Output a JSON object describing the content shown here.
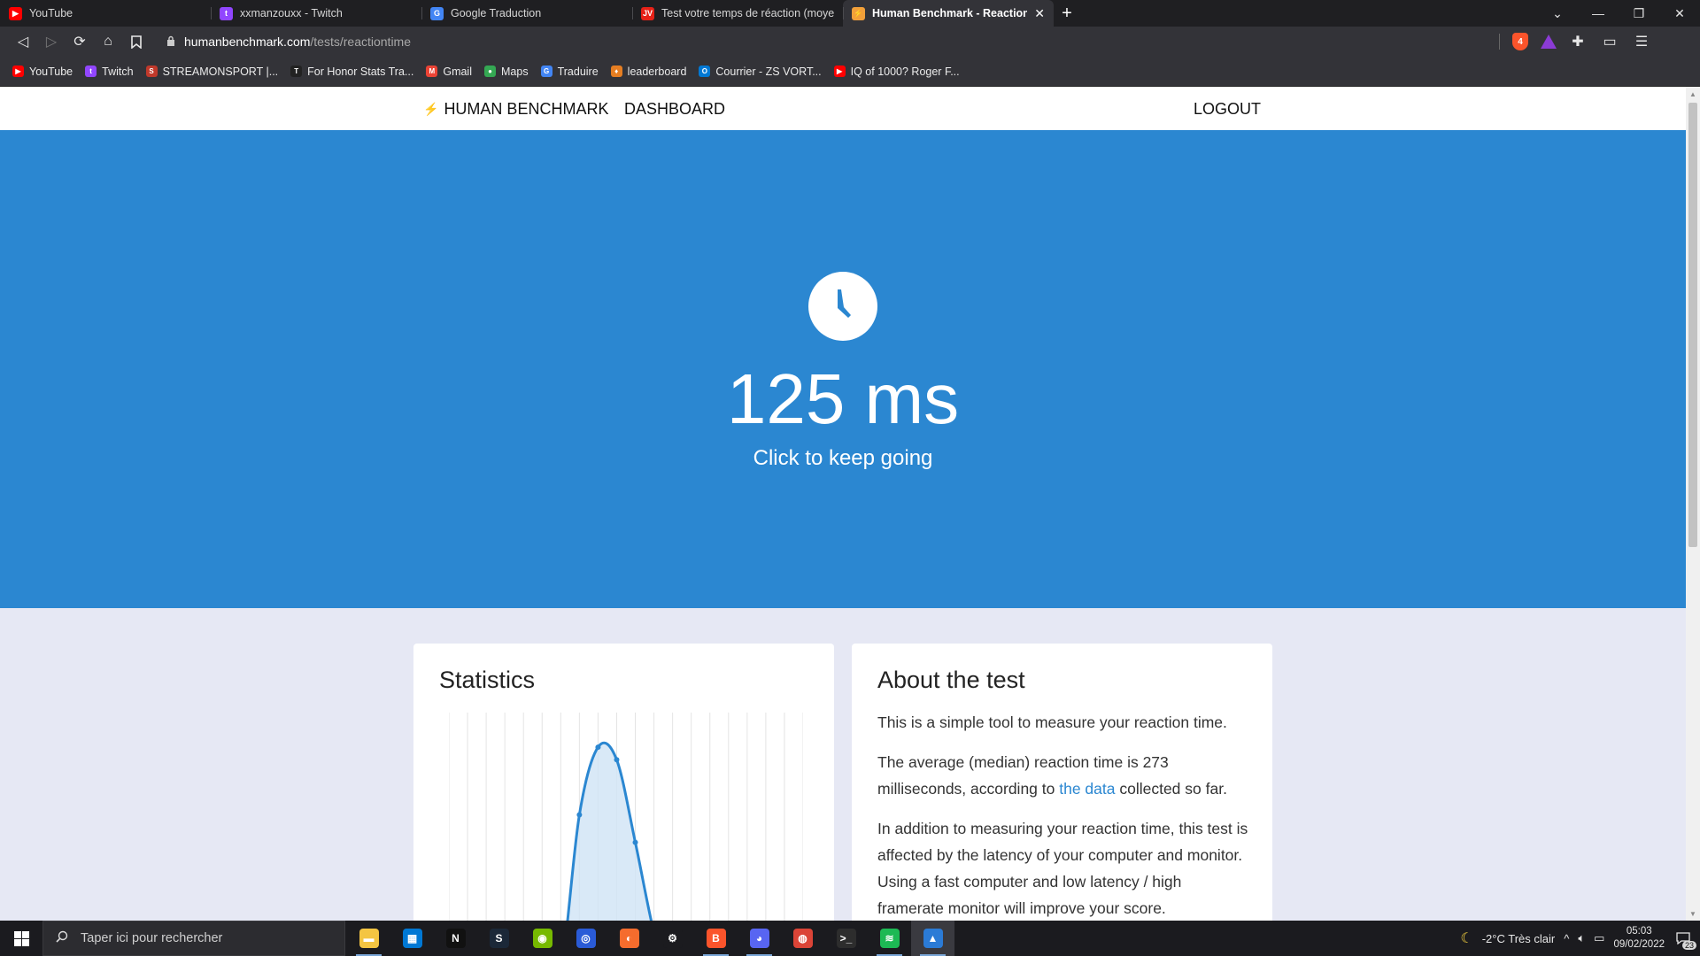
{
  "tabs": [
    {
      "label": "YouTube",
      "favicon": "youtube-icon",
      "color": "#ff0000",
      "glyph": "▶"
    },
    {
      "label": "xxmanzouxx - Twitch",
      "favicon": "twitch-icon",
      "color": "#9146ff",
      "glyph": "t"
    },
    {
      "label": "Google Traduction",
      "favicon": "google-translate-icon",
      "color": "#4285f4",
      "glyph": "G"
    },
    {
      "label": "Test votre temps de réaction (moyenn",
      "favicon": "jv-icon",
      "color": "#e62117",
      "glyph": "JV"
    },
    {
      "label": "Human Benchmark - Reaction Tin",
      "favicon": "humanbenchmark-icon",
      "color": "#f2a03a",
      "glyph": "⚡"
    }
  ],
  "url": {
    "host": "humanbenchmark.com",
    "path": "/tests/reactiontime",
    "shield_count": "4"
  },
  "bookmarks": [
    {
      "label": "YouTube",
      "icon": "youtube-icon",
      "color": "#ff0000",
      "glyph": "▶"
    },
    {
      "label": "Twitch",
      "icon": "twitch-icon",
      "color": "#9146ff",
      "glyph": "t"
    },
    {
      "label": "STREAMONSPORT |...",
      "icon": "streamonsport-icon",
      "color": "#c0392b",
      "glyph": "S"
    },
    {
      "label": "For Honor Stats Tra...",
      "icon": "trn-icon",
      "color": "#222222",
      "glyph": "T"
    },
    {
      "label": "Gmail",
      "icon": "gmail-icon",
      "color": "#ea4335",
      "glyph": "M"
    },
    {
      "label": "Maps",
      "icon": "maps-icon",
      "color": "#34a853",
      "glyph": "●"
    },
    {
      "label": "Traduire",
      "icon": "google-translate-icon",
      "color": "#4285f4",
      "glyph": "G"
    },
    {
      "label": "leaderboard",
      "icon": "leaderboard-icon",
      "color": "#e67e22",
      "glyph": "♦"
    },
    {
      "label": "Courrier - ZS VORT...",
      "icon": "outlook-icon",
      "color": "#0078d4",
      "glyph": "O"
    },
    {
      "label": "IQ of 1000? Roger F...",
      "icon": "youtube-icon",
      "color": "#ff0000",
      "glyph": "▶"
    }
  ],
  "site": {
    "brand": "HUMAN BENCHMARK",
    "dashboard": "DASHBOARD",
    "logout": "LOGOUT"
  },
  "hero": {
    "result": "125 ms",
    "subtitle": "Click to keep going",
    "bg_color": "#2b87d1"
  },
  "stats": {
    "title": "Statistics"
  },
  "about": {
    "title": "About the test",
    "p1": "This is a simple tool to measure your reaction time.",
    "p2_before": "The average (median) reaction time is 273 milliseconds, according to ",
    "p2_link": "the data",
    "p2_after": " collected so far.",
    "p3": "In addition to measuring your reaction time, this test is affected by the latency of your computer and monitor. Using a fast computer and low latency / high framerate monitor will improve your score."
  },
  "taskbar": {
    "search_placeholder": "Taper ici pour rechercher",
    "apps": [
      {
        "name": "file-explorer-icon",
        "color": "#f4c542",
        "glyph": "▬",
        "running": true
      },
      {
        "name": "store-icon",
        "color": "#0078d4",
        "glyph": "▦",
        "running": false
      },
      {
        "name": "netflix-icon",
        "color": "#111111",
        "glyph": "N",
        "running": false
      },
      {
        "name": "steam-icon",
        "color": "#1b2838",
        "glyph": "S",
        "running": false
      },
      {
        "name": "nvidia-icon",
        "color": "#76b900",
        "glyph": "◉",
        "running": false
      },
      {
        "name": "app-icon",
        "color": "#2a5bd7",
        "glyph": "◎",
        "running": false
      },
      {
        "name": "origin-icon",
        "color": "#f56c2d",
        "glyph": "◐",
        "running": false
      },
      {
        "name": "settings-icon",
        "color": "#1b1b1f",
        "glyph": "⚙",
        "running": false
      },
      {
        "name": "brave-icon",
        "color": "#fb542b",
        "glyph": "B",
        "running": true
      },
      {
        "name": "discord-icon",
        "color": "#5865f2",
        "glyph": "◕",
        "running": true
      },
      {
        "name": "chrome-icon",
        "color": "#db4437",
        "glyph": "◍",
        "running": false
      },
      {
        "name": "terminal-icon",
        "color": "#2d2d2d",
        "glyph": ">_",
        "running": false
      },
      {
        "name": "spotify-icon",
        "color": "#1db954",
        "glyph": "≋",
        "running": true
      },
      {
        "name": "photos-icon",
        "color": "#2b7bd6",
        "glyph": "▲",
        "running": true
      }
    ],
    "weather": "-2°C  Très clair",
    "time": "05:03",
    "date": "09/02/2022",
    "notifications": "23"
  },
  "chart_data": {
    "type": "area",
    "title": "Statistics",
    "note": "reaction time distribution curve (no axis labels shown)",
    "x": [
      0,
      1,
      2,
      3,
      4,
      5,
      6,
      7,
      8,
      9,
      10,
      11,
      12,
      13,
      14,
      15,
      16,
      17,
      18,
      19
    ],
    "values": [
      0,
      0,
      0,
      0,
      0,
      0,
      0.1,
      0.73,
      1.0,
      0.95,
      0.62,
      0.26,
      0.02,
      0,
      0,
      0,
      0,
      0,
      0,
      0
    ],
    "ylim": [
      0,
      1.05
    ],
    "grid": true,
    "line_color": "#2b87d1",
    "fill_color": "#cfe3f5"
  }
}
